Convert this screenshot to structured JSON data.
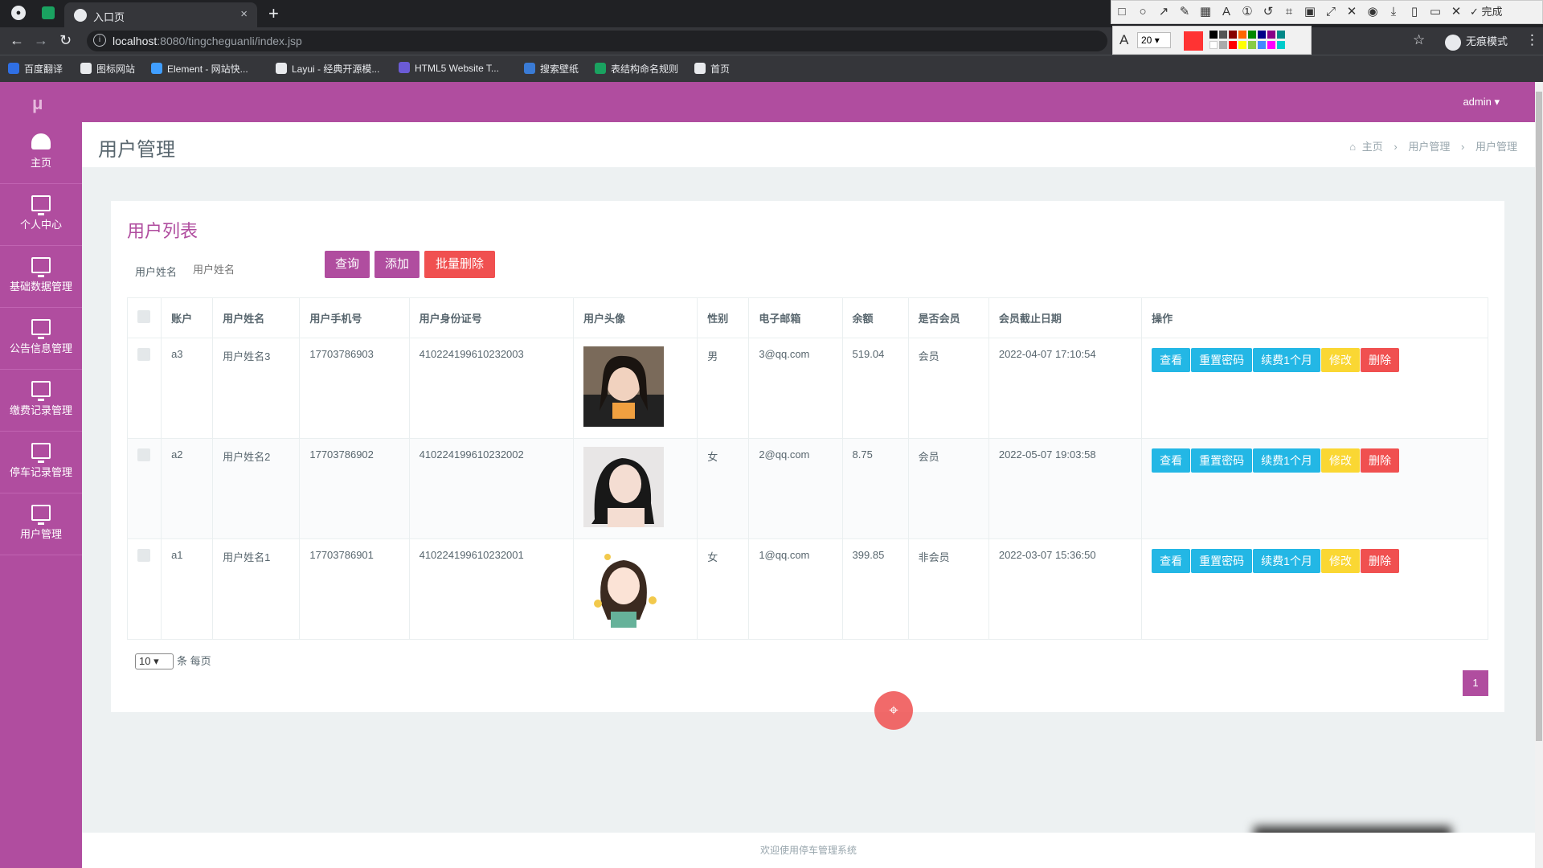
{
  "browser": {
    "tab_title": "入口页",
    "tab_close": "×",
    "new_tab": "+",
    "url_host": "localhost",
    "url_path": ":8080/tingcheguanli/index.jsp",
    "incognito_label": "无痕模式",
    "bookmarks": [
      {
        "label": "百度翻译",
        "color": "#2f6fe4"
      },
      {
        "label": "图标网站",
        "color": "#e8eaed"
      },
      {
        "label": "Element - 网站快...",
        "color": "#409eff"
      },
      {
        "label": "Layui - 经典开源模...",
        "color": "#e8eaed"
      },
      {
        "label": "HTML5 Website T...",
        "color": "#6b5bd6"
      },
      {
        "label": "搜索壁纸",
        "color": "#3a7bd5"
      },
      {
        "label": "表结构命名规则",
        "color": "#1aa260"
      },
      {
        "label": "首页",
        "color": "#e8eaed"
      }
    ]
  },
  "screenshot_tool": {
    "done_label": "完成",
    "font_size": "20",
    "current_color": "#ff3333"
  },
  "app": {
    "logo": "μ",
    "user": "admin ▾",
    "accent": "#b04d9f",
    "sidebar": [
      {
        "label": "主页",
        "icon": "dashboard-icon"
      },
      {
        "label": "个人中心",
        "icon": "monitor-icon"
      },
      {
        "label": "基础数据管理",
        "icon": "monitor-icon"
      },
      {
        "label": "公告信息管理",
        "icon": "monitor-icon"
      },
      {
        "label": "缴费记录管理",
        "icon": "monitor-icon"
      },
      {
        "label": "停车记录管理",
        "icon": "monitor-icon"
      },
      {
        "label": "用户管理",
        "icon": "monitor-icon"
      }
    ],
    "page_title": "用户管理",
    "breadcrumb": [
      "主页",
      "›",
      "用户管理",
      "›",
      "用户管理"
    ],
    "card_title": "用户列表",
    "search": {
      "label": "用户姓名",
      "placeholder": "用户姓名"
    },
    "buttons": {
      "query": "查询",
      "add": "添加",
      "batch_delete": "批量删除"
    },
    "columns": [
      "账户",
      "用户姓名",
      "用户手机号",
      "用户身份证号",
      "用户头像",
      "性别",
      "电子邮箱",
      "余额",
      "是否会员",
      "会员截止日期",
      "操作"
    ],
    "rows": [
      {
        "account": "a3",
        "name": "用户姓名3",
        "phone": "17703786903",
        "id_card": "410224199610232003",
        "gender": "男",
        "email": "3@qq.com",
        "balance": "519.04",
        "member": "会员",
        "expire": "2022-04-07 17:10:54"
      },
      {
        "account": "a2",
        "name": "用户姓名2",
        "phone": "17703786902",
        "id_card": "410224199610232002",
        "gender": "女",
        "email": "2@qq.com",
        "balance": "8.75",
        "member": "会员",
        "expire": "2022-05-07 19:03:58"
      },
      {
        "account": "a1",
        "name": "用户姓名1",
        "phone": "17703786901",
        "id_card": "410224199610232001",
        "gender": "女",
        "email": "1@qq.com",
        "balance": "399.85",
        "member": "非会员",
        "expire": "2022-03-07 15:36:50"
      }
    ],
    "row_actions": {
      "view": "查看",
      "reset": "重置密码",
      "renew": "续费1个月",
      "edit": "修改",
      "delete": "删除"
    },
    "page_size": "10",
    "page_size_suffix": "条 每页",
    "current_page": "1",
    "footer": "欢迎使用停车管理系统"
  }
}
